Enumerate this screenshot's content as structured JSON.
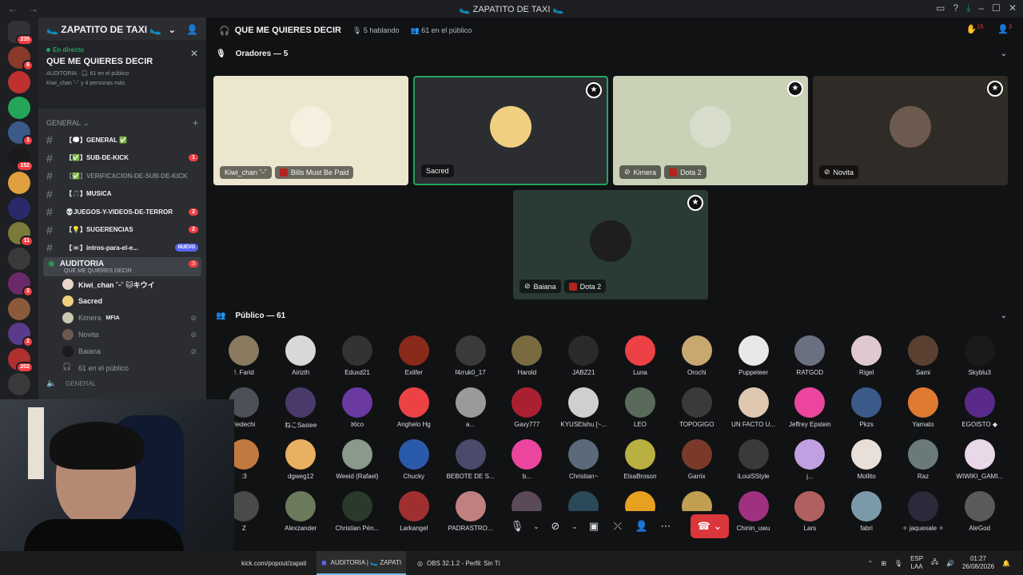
{
  "window": {
    "title": "🥿 ZAPATITO DE TAXI 🥿"
  },
  "server": {
    "name": "🥿 ZAPATITO DE TAXI 🥿"
  },
  "guild_badges": [
    "235",
    "6",
    "1",
    "152",
    "11",
    "2",
    "2",
    "202"
  ],
  "live": {
    "tag": "En directo",
    "name": "QUE ME QUIERES DECIR",
    "meta": "AUDITORIA · 🎧 61 en el público",
    "listeners": "Kiwi_chan ˘ᵕ˘ y 4 personas más"
  },
  "category": "GENERAL",
  "channels": [
    {
      "name": "【💭】GENERAL ✅",
      "badge": ""
    },
    {
      "name": "【✅】SUB-DE-KICK",
      "badge": "1"
    },
    {
      "name": "【✅】VERIFICACION-DE-SUB-DE-KICK",
      "badge": "",
      "dim": true
    },
    {
      "name": "【🎵】MUSICA",
      "badge": ""
    },
    {
      "name": "💀JUEGOS-Y-VIDEOS-DE-TERROR",
      "badge": "2"
    },
    {
      "name": "【💡】SUGERENCIAS",
      "badge": "2"
    },
    {
      "name": "【📼】intros-para-el-e...",
      "badge": "",
      "nuevo": "NUEVO"
    }
  ],
  "voice": {
    "name": "AUDITORIA",
    "sub": "QUE ME QUIERES DECIR",
    "badge": "3",
    "next": "GENERAL"
  },
  "voice_users": [
    {
      "name": "Kiwi_chan ˘ᵕ˘ 🐱キウイ",
      "tag": "",
      "color": "#e8d6c8"
    },
    {
      "name": "Sacred",
      "tag": "",
      "color": "#f0d080"
    },
    {
      "name": "Kimera",
      "tag": "MFIA",
      "color": "#c8c8b0"
    },
    {
      "name": "Novita",
      "tag": "",
      "color": "#6a5a50"
    },
    {
      "name": "Baiana",
      "tag": "",
      "color": "#1a1a1a"
    },
    {
      "name": "61 en el público",
      "tag": "",
      "color": ""
    }
  ],
  "header": {
    "title": "QUE ME QUIERES DECIR",
    "speaking": "5 hablando",
    "audience": "61 en el público",
    "badge1": "15",
    "badge2": "3"
  },
  "speakers_label": "Oradores — 5",
  "speakers": [
    {
      "name": "Kiwi_chan ˘ᵕ˘",
      "game": "Bills Must Be Paid",
      "bg": "#ece6cf",
      "av": "#f5efe0",
      "star": false
    },
    {
      "name": "Sacred",
      "game": "",
      "bg": "#2b2d31",
      "av": "#f0d080",
      "star": true
    },
    {
      "name": "Kimera",
      "game": "Dota 2",
      "bg": "#c9d1b6",
      "av": "#d8dccb",
      "star": true
    },
    {
      "name": "Novita",
      "game": "",
      "bg": "#2f2b27",
      "av": "#6b5a4d",
      "star": true
    },
    {
      "name": "Baiana",
      "game": "Dota 2",
      "bg": "#2a3b36",
      "av": "#1e1e1e",
      "star": true
    }
  ],
  "public_label": "Público — 61",
  "audience": [
    {
      "n": "!. Farid",
      "c": "#8a7a60"
    },
    {
      "n": "Airizth",
      "c": "#d8d8d8"
    },
    {
      "n": "Eduxd21",
      "c": "#333"
    },
    {
      "n": "Exlifer",
      "c": "#8a2a1a"
    },
    {
      "n": "f4rruk0_17",
      "c": "#3a3a3a"
    },
    {
      "n": "Harold",
      "c": "#7a6a40"
    },
    {
      "n": "JABZ21",
      "c": "#2a2a2a"
    },
    {
      "n": "Luna",
      "c": "#ed4245"
    },
    {
      "n": "Orochi",
      "c": "#c8a870"
    },
    {
      "n": "Puppeteer",
      "c": "#e8e8e8"
    },
    {
      "n": "RATGOD",
      "c": "#6a7080"
    },
    {
      "n": "Rigel",
      "c": "#e0c8d0"
    },
    {
      "n": "Sami",
      "c": "#5a4030"
    },
    {
      "n": "Skyblu3",
      "c": "#1a1a1a"
    },
    {
      "n": "riedechi",
      "c": "#4e5058"
    },
    {
      "n": "ねこSasiee",
      "c": "#4a3a6a"
    },
    {
      "n": "ℵico",
      "c": "#6a3aa0"
    },
    {
      "n": "Anghelo Hg",
      "c": "#ed4245"
    },
    {
      "n": "a...",
      "c": "#9a9a9a"
    },
    {
      "n": "Gavy777",
      "c": "#aa2030"
    },
    {
      "n": "KYUSElshu [~...",
      "c": "#cfcfcf"
    },
    {
      "n": "LEO",
      "c": "#5a6a5a"
    },
    {
      "n": "TOPOGIGO",
      "c": "#3a3a3a"
    },
    {
      "n": "UN FACTO U...",
      "c": "#e0c8b0"
    },
    {
      "n": "Jeffrey Epstein",
      "c": "#eb459e"
    },
    {
      "n": "Pkzs",
      "c": "#3a5a8a"
    },
    {
      "n": "Yamato",
      "c": "#e07a30"
    },
    {
      "n": "EGOISTO ◆",
      "c": "#5a2a8a"
    },
    {
      "n": ":3",
      "c": "#c07a40"
    },
    {
      "n": "dgweg12",
      "c": "#e8b060"
    },
    {
      "n": "Weeid (Rafael)",
      "c": "#8a9a8a"
    },
    {
      "n": "Chucky",
      "c": "#2a5aaa"
    },
    {
      "n": "BEBOTE DE S...",
      "c": "#4a4a6a"
    },
    {
      "n": "b...",
      "c": "#eb459e"
    },
    {
      "n": "Christian~",
      "c": "#5a6a7a"
    },
    {
      "n": "ElsaBroson",
      "c": "#b8b040"
    },
    {
      "n": "Garrix",
      "c": "#7a3a2a"
    },
    {
      "n": "iLouiSStyle",
      "c": "#3a3a3a"
    },
    {
      "n": "j...",
      "c": "#c0a0e0"
    },
    {
      "n": "Mollito",
      "c": "#e8e0d8"
    },
    {
      "n": "Raz",
      "c": "#6a7a7a"
    },
    {
      "n": "WIWIKI_GAMI...",
      "c": "#e8d8e8"
    },
    {
      "n": "Z",
      "c": "#4a4a4a"
    },
    {
      "n": "Alexzander",
      "c": "#6a7a5a"
    },
    {
      "n": "Christian Pén...",
      "c": "#2a3a2a"
    },
    {
      "n": "Larkangel",
      "c": "#a03030"
    },
    {
      "n": "PADRASTRO...",
      "c": "#c08080"
    },
    {
      "n": "",
      "c": "#5a4a5a"
    },
    {
      "n": "",
      "c": "#2a4a5a"
    },
    {
      "n": "",
      "c": "#e8a020"
    },
    {
      "n": "",
      "c": "#c0a050"
    },
    {
      "n": "Chinin_uwu",
      "c": "#a03080"
    },
    {
      "n": "Lars",
      "c": "#b06060"
    },
    {
      "n": "fabri",
      "c": "#7a9aaa"
    },
    {
      "n": "✧ jaquexale ✧",
      "c": "#2a2a3a"
    },
    {
      "n": "AleGod",
      "c": "#5a5a5a"
    }
  ],
  "taskbar": {
    "kick": "kick.com/popout/zapati",
    "discord": "AUDITORIA | 🥿 ZAPATI",
    "obs": "OBS 32.1.2 - Perfil: Sin Tí",
    "lang1": "ESP",
    "lang2": "LAA",
    "time": "01:27",
    "date": "26/08/2026"
  }
}
